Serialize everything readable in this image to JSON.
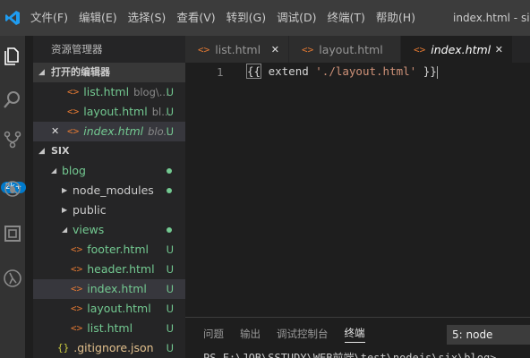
{
  "menu": {
    "items": [
      "文件(F)",
      "编辑(E)",
      "选择(S)",
      "查看(V)",
      "转到(G)",
      "调试(D)",
      "终端(T)",
      "帮助(H)"
    ],
    "window_title": "index.html - six -"
  },
  "activity": {
    "scm_badge": "2k+"
  },
  "sidebar": {
    "title": "资源管理器",
    "open_editors": {
      "header": "打开的编辑器",
      "items": [
        {
          "label": "list.html",
          "desc": "blog\\...",
          "status": "U"
        },
        {
          "label": "layout.html",
          "desc": "bl...",
          "status": "U"
        },
        {
          "label": "index.html",
          "desc": "blo...",
          "status": "U"
        }
      ]
    },
    "folder": {
      "header": "SIX",
      "items": [
        {
          "label": "blog"
        },
        {
          "label": "node_modules"
        },
        {
          "label": "public"
        },
        {
          "label": "views"
        },
        {
          "label": "footer.html",
          "status": "U"
        },
        {
          "label": "header.html",
          "status": "U"
        },
        {
          "label": "index.html",
          "status": "U"
        },
        {
          "label": "layout.html",
          "status": "U"
        },
        {
          "label": "list.html",
          "status": "U"
        },
        {
          "label": ".gitignore.json",
          "status": "U"
        }
      ]
    }
  },
  "tabs": [
    {
      "label": "list.html"
    },
    {
      "label": "layout.html"
    },
    {
      "label": "index.html"
    }
  ],
  "editor": {
    "line_number": "1",
    "code_open": "{{",
    "code_keyword": " extend ",
    "code_string": "'./layout.html'",
    "code_close": " }}"
  },
  "panel": {
    "tabs": [
      "问题",
      "输出",
      "调试控制台",
      "终端"
    ],
    "terminal_select": "5: node",
    "terminal_line": "PS F:\\JOB\\SSTUDY\\WEB前端\\test\\nodejs\\six\\blog>"
  },
  "colors": {
    "accent": "#007acc",
    "untracked_green": "#73c991",
    "html_icon": "#e37933"
  }
}
